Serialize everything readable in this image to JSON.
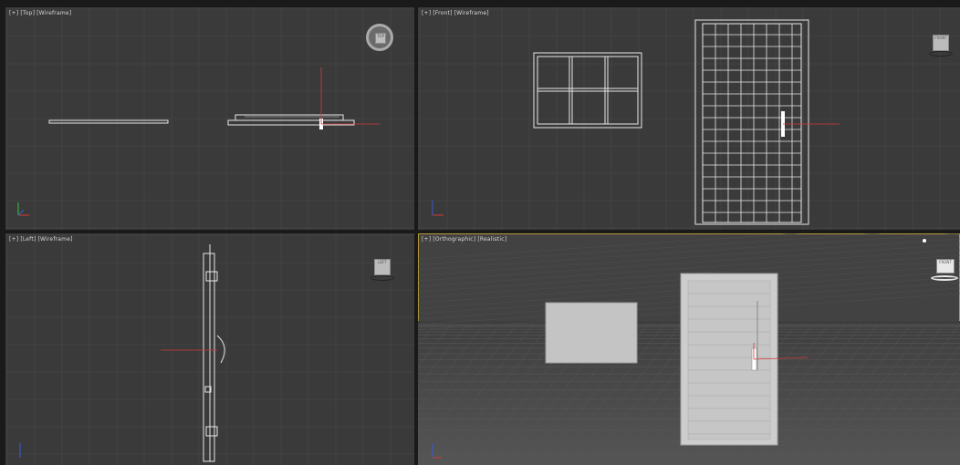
{
  "viewports": {
    "top": {
      "plus": "[+]",
      "view": "[Top]",
      "shading": "[Wireframe]",
      "cube_face": "TOP"
    },
    "front": {
      "plus": "[+]",
      "view": "[Front]",
      "shading": "[Wireframe]",
      "cube_face": "FRONT"
    },
    "left": {
      "plus": "[+]",
      "view": "[Left]",
      "shading": "[Wireframe]",
      "cube_face": "LEFT"
    },
    "persp": {
      "plus": "[+]",
      "view": "[Orthographic]",
      "shading": "[Realistic]",
      "cube_face": "FRONT"
    }
  },
  "colors": {
    "viewport_bg": "#3a3a3a",
    "grid_line": "#4a4a4a",
    "wire": "#e8e8e8",
    "axis_x": "#d23a3a",
    "axis_y": "#3ac23a",
    "axis_z": "#3a5ad2",
    "active_border": "#b89b3a"
  },
  "icons": [
    "view-cube-icon",
    "axis-tripod-icon",
    "steering-wheel-icon"
  ]
}
